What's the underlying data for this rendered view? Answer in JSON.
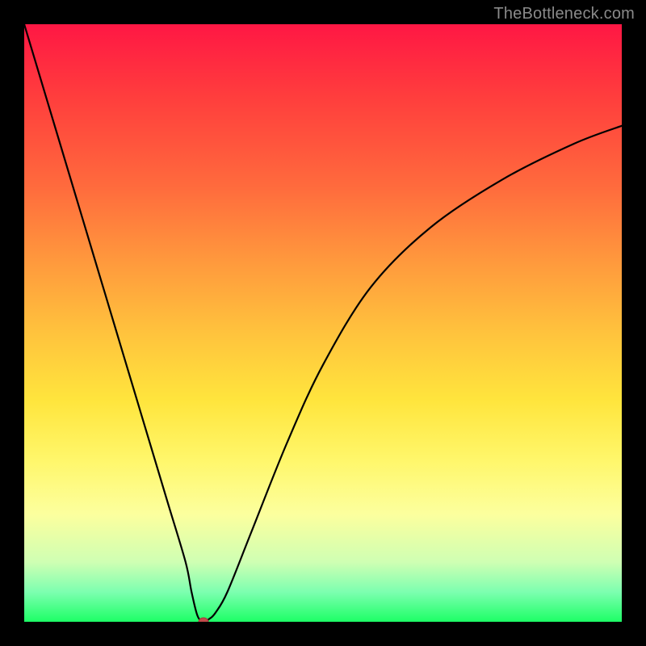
{
  "watermark": "TheBottleneck.com",
  "chart_data": {
    "type": "line",
    "title": "",
    "xlabel": "",
    "ylabel": "",
    "xlim": [
      0,
      100
    ],
    "ylim": [
      0,
      100
    ],
    "grid": false,
    "legend": false,
    "series": [
      {
        "name": "bottleneck-curve",
        "x": [
          0,
          3,
          6,
          9,
          12,
          15,
          18,
          21,
          24,
          27,
          28,
          29,
          30,
          31,
          32,
          34,
          38,
          44,
          50,
          58,
          68,
          80,
          92,
          100
        ],
        "y": [
          100,
          90,
          80,
          70,
          60,
          50,
          40,
          30,
          20,
          10,
          5,
          1,
          0,
          0.5,
          1.5,
          5,
          15,
          30,
          43,
          56,
          66,
          74,
          80,
          83
        ]
      }
    ],
    "marker": {
      "name": "optimal-point",
      "x": 30,
      "y": 0,
      "color": "#c24a4a",
      "rx": 6,
      "ry": 5
    }
  }
}
